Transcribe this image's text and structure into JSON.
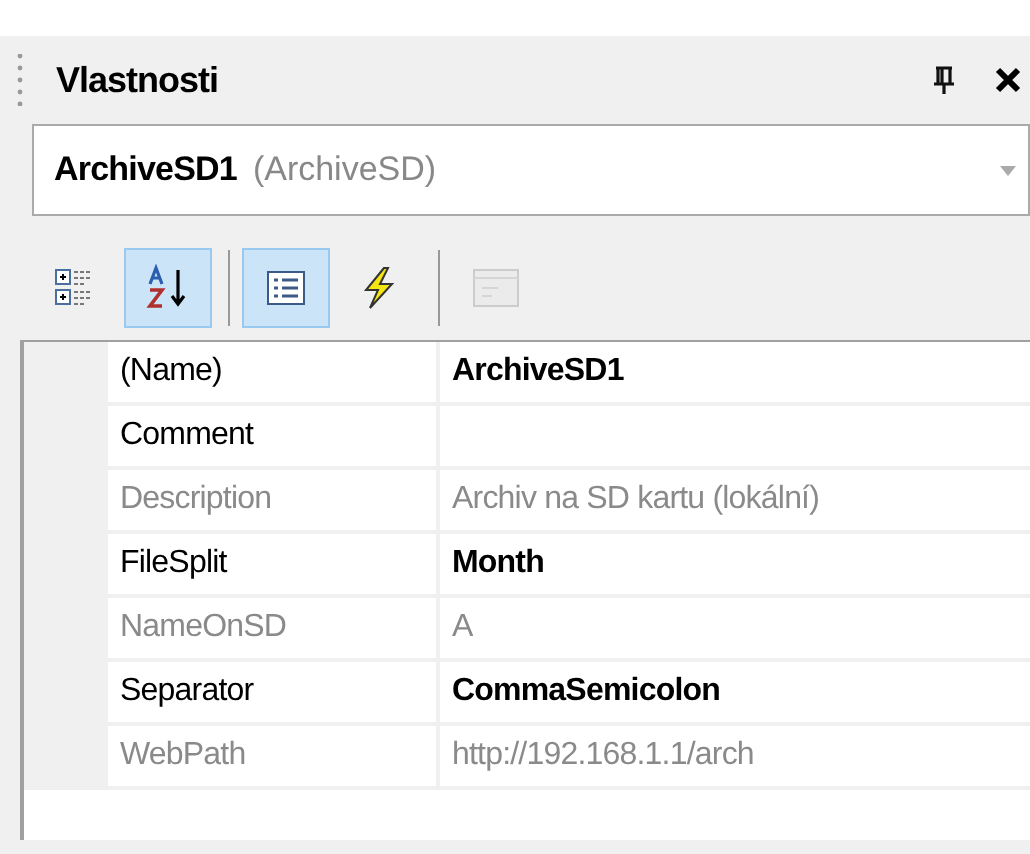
{
  "panel": {
    "title": "Vlastnosti"
  },
  "object_selector": {
    "name": "ArchiveSD1",
    "type": "(ArchiveSD)"
  },
  "toolbar": [
    {
      "kind": "categorized",
      "selected": false,
      "disabled": false
    },
    {
      "kind": "alphabetical",
      "selected": true,
      "disabled": false
    },
    {
      "kind": "properties",
      "selected": true,
      "disabled": false
    },
    {
      "kind": "events",
      "selected": false,
      "disabled": false
    },
    {
      "kind": "property-pages",
      "selected": false,
      "disabled": true
    }
  ],
  "properties": [
    {
      "name": "(Name)",
      "value": "ArchiveSD1",
      "read_only": false,
      "modified": true
    },
    {
      "name": "Comment",
      "read_only": false
    },
    {
      "name": "Description",
      "value": "Archiv na SD kartu (lokální)",
      "read_only": true,
      "modified": false
    },
    {
      "name": "FileSplit",
      "value": "Month",
      "read_only": false,
      "modified": true
    },
    {
      "name": "NameOnSD",
      "value": "A",
      "read_only": true,
      "modified": false
    },
    {
      "name": "Separator",
      "value": "CommaSemicolon",
      "read_only": false,
      "modified": true
    },
    {
      "name": "WebPath",
      "value": "http://192.168.1.1/arch",
      "read_only": true,
      "modified": false
    }
  ]
}
